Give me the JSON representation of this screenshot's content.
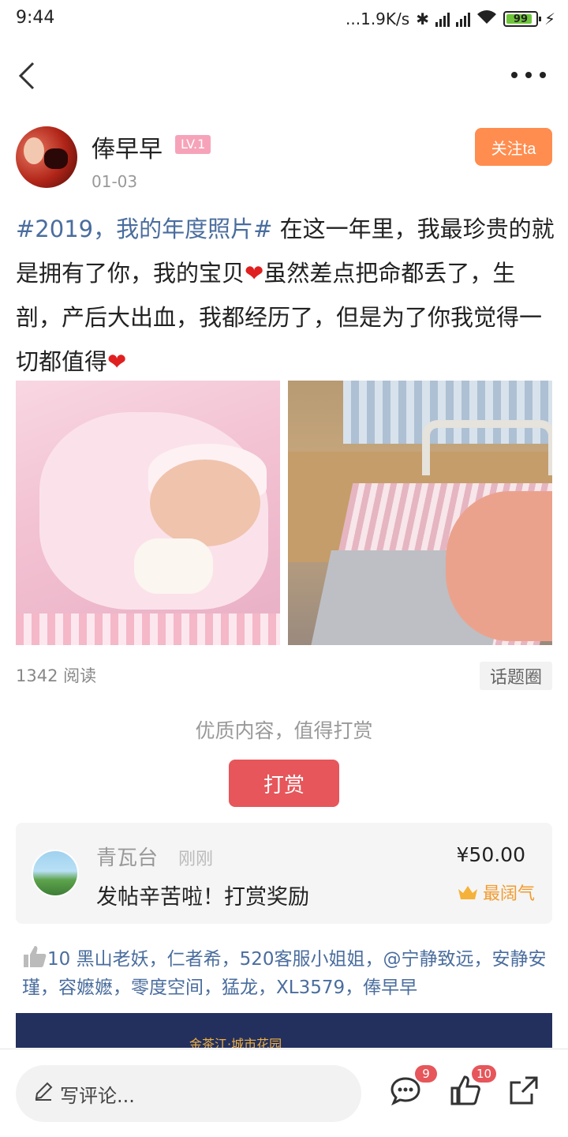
{
  "status_bar": {
    "time": "9:44",
    "speed": "...1.9K/s",
    "battery": "99"
  },
  "author": {
    "name": "俸早早",
    "level": "LV.1",
    "date": "01-03",
    "follow_label": "关注ta"
  },
  "post": {
    "tag": "#2019，我的年度照片#",
    "text1": " 在这一年里，我最珍贵的就是拥有了你，我的宝贝",
    "text2": "虽然差点把命都丢了，生剖，产后大出血，我都经历了，但是为了你我觉得一切都值得",
    "reads": "1342 阅读",
    "topic_label": "话题圈"
  },
  "reward": {
    "hint": "优质内容，值得打赏",
    "button_label": "打赏",
    "record": {
      "name": "青瓦台",
      "time": "刚刚",
      "message": "发帖辛苦啦！打赏奖励",
      "amount": "¥50.00",
      "badge": "最阔气"
    }
  },
  "likes": {
    "count": "10",
    "names": " 黑山老妖，仁者希，520客服小姐姐，@宁静致远，安静安瑾，容嬷嬷，零度空间，猛龙，XL3579，俸早早"
  },
  "banner": {
    "text": "金茶江·城市花园"
  },
  "bottom_bar": {
    "comment_placeholder": "写评论...",
    "comment_count": "9",
    "like_count": "10"
  },
  "colors": {
    "follow": "#ff8d4f",
    "reward": "#e6565a",
    "tag": "#4a6d9e",
    "level": "#f6a3b9"
  }
}
